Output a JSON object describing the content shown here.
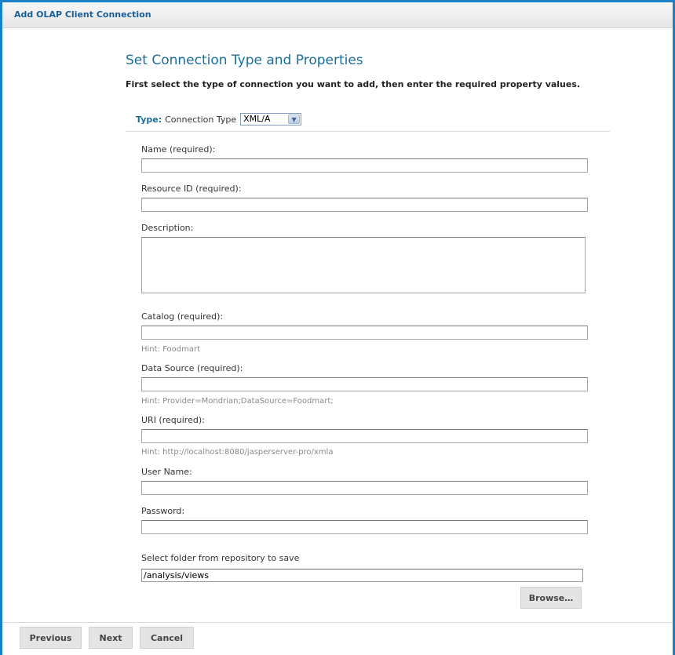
{
  "window": {
    "title": "Add OLAP Client Connection"
  },
  "page": {
    "heading": "Set Connection Type and Properties",
    "instructions": "First select the type of connection you want to add, then enter the required property values."
  },
  "connection_type": {
    "type_label": "Type:",
    "label": "Connection Type",
    "selected": "XML/A"
  },
  "fields": {
    "name": {
      "label": "Name (required):",
      "value": ""
    },
    "resource_id": {
      "label": "Resource ID (required):",
      "value": ""
    },
    "description": {
      "label": "Description:",
      "value": ""
    },
    "catalog": {
      "label": "Catalog (required):",
      "value": "",
      "hint": "Hint: Foodmart"
    },
    "data_source": {
      "label": "Data Source (required):",
      "value": "",
      "hint": "Hint: Provider=Mondrian;DataSource=Foodmart;"
    },
    "uri": {
      "label": "URI (required):",
      "value": "",
      "hint": "Hint: http://localhost:8080/jasperserver-pro/xmla"
    },
    "user_name": {
      "label": "User Name:",
      "value": ""
    },
    "password": {
      "label": "Password:",
      "value": ""
    },
    "folder": {
      "label": "Select folder from repository to save",
      "value": "/analysis/views"
    }
  },
  "buttons": {
    "browse": "Browse…",
    "previous": "Previous",
    "next": "Next",
    "cancel": "Cancel"
  },
  "colors": {
    "frame_border": "#1a80c8",
    "title_text": "#1a5e96",
    "heading_text": "#1a6e9a",
    "button_bg": "#e4e4e4"
  }
}
